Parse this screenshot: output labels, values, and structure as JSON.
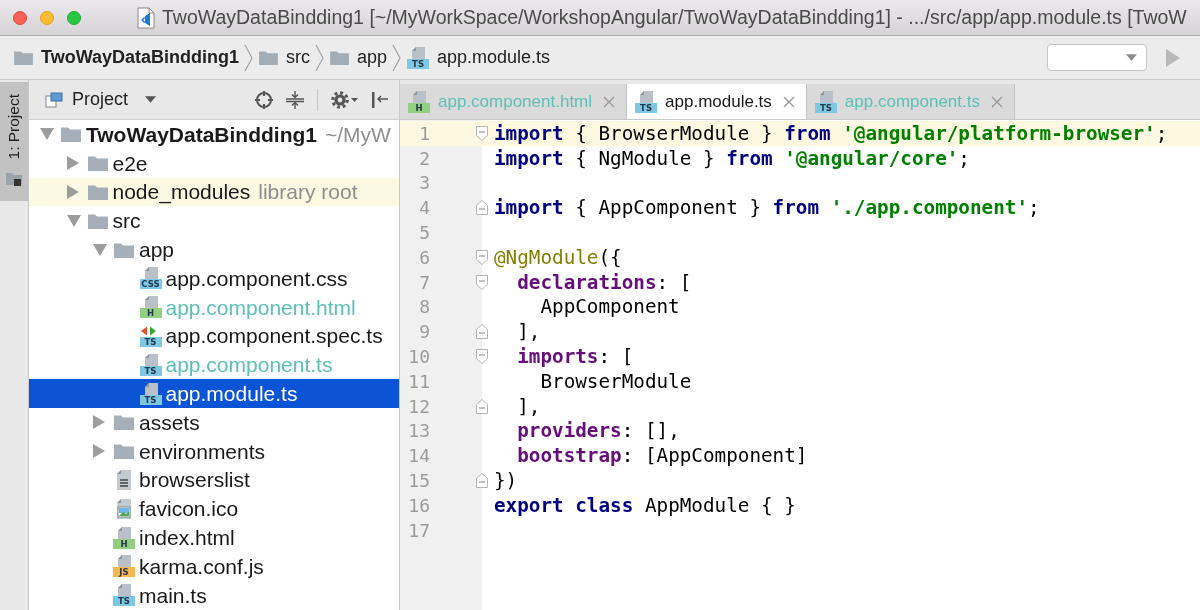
{
  "window": {
    "title": "TwoWayDataBindding1 [~/MyWorkSpace/WorkshopAngular/TwoWayDataBindding1] - .../src/app/app.module.ts [TwoW"
  },
  "breadcrumb": [
    {
      "label": "TwoWayDataBindding1",
      "kind": "project"
    },
    {
      "label": "src",
      "kind": "folder"
    },
    {
      "label": "app",
      "kind": "folder"
    },
    {
      "label": "app.module.ts",
      "kind": "ts",
      "badge": "TS"
    }
  ],
  "side_tabs": [
    {
      "label": "1: Project",
      "selected": true
    }
  ],
  "project_panel": {
    "title": "Project"
  },
  "tree": [
    {
      "name": "TwoWayDataBindding1",
      "kind": "project",
      "note": "~/MyW",
      "expanded": true,
      "selected": false,
      "highlighted": false,
      "children": [
        {
          "name": "e2e",
          "kind": "folder",
          "expanded": false,
          "selected": false,
          "highlighted": false
        },
        {
          "name": "node_modules",
          "kind": "folder",
          "note": "library root",
          "expanded": false,
          "selected": false,
          "highlighted": true
        },
        {
          "name": "src",
          "kind": "folder",
          "expanded": true,
          "selected": false,
          "highlighted": false,
          "children": [
            {
              "name": "app",
              "kind": "folder",
              "expanded": true,
              "selected": false,
              "highlighted": false,
              "children": [
                {
                  "name": "app.component.css",
                  "kind": "css",
                  "badge": "CSS",
                  "selected": false,
                  "highlighted": false
                },
                {
                  "name": "app.component.html",
                  "kind": "html",
                  "badge": "H",
                  "color": "#5cc0b6",
                  "selected": false,
                  "highlighted": false
                },
                {
                  "name": "app.component.spec.ts",
                  "kind": "test",
                  "badge": "TS",
                  "selected": false,
                  "highlighted": false
                },
                {
                  "name": "app.component.ts",
                  "kind": "ts",
                  "badge": "TS",
                  "color": "#5cc0b6",
                  "selected": false,
                  "highlighted": false
                },
                {
                  "name": "app.module.ts",
                  "kind": "ts",
                  "badge": "TS",
                  "selected": true,
                  "highlighted": false
                }
              ]
            },
            {
              "name": "assets",
              "kind": "folder",
              "expanded": false,
              "selected": false,
              "highlighted": false
            },
            {
              "name": "environments",
              "kind": "folder",
              "expanded": false,
              "selected": false,
              "highlighted": false
            },
            {
              "name": "browserslist",
              "kind": "text",
              "selected": false,
              "highlighted": false
            },
            {
              "name": "favicon.ico",
              "kind": "image",
              "selected": false,
              "highlighted": false
            },
            {
              "name": "index.html",
              "kind": "html",
              "badge": "H",
              "selected": false,
              "highlighted": false
            },
            {
              "name": "karma.conf.js",
              "kind": "js",
              "badge": "JS",
              "selected": false,
              "highlighted": false
            },
            {
              "name": "main.ts",
              "kind": "ts",
              "badge": "TS",
              "selected": false,
              "highlighted": false
            }
          ]
        }
      ]
    }
  ],
  "editor_tabs": [
    {
      "label": "app.component.html",
      "kind": "html",
      "badge": "H",
      "selected": false,
      "color": "#5cc0b6"
    },
    {
      "label": "app.module.ts",
      "kind": "ts",
      "badge": "TS",
      "selected": true
    },
    {
      "label": "app.component.ts",
      "kind": "ts",
      "badge": "TS",
      "selected": false,
      "color": "#5cc0b6"
    }
  ],
  "code_lines": [
    {
      "number": "1",
      "kind": "open",
      "current": true,
      "segments": [
        {
          "text": "import",
          "kind": "keyword"
        },
        {
          "text": " { BrowserModule } ",
          "kind": "plain"
        },
        {
          "text": "from ",
          "kind": "keyword"
        },
        {
          "text": "'@angular/platform-browser'",
          "kind": "string"
        },
        {
          "text": ";",
          "kind": "plain"
        }
      ]
    },
    {
      "number": "2",
      "kind": "plain",
      "current": false,
      "segments": [
        {
          "text": "import",
          "kind": "keyword"
        },
        {
          "text": " { NgModule } ",
          "kind": "plain"
        },
        {
          "text": "from ",
          "kind": "keyword"
        },
        {
          "text": "'@angular/core'",
          "kind": "string"
        },
        {
          "text": ";",
          "kind": "plain"
        }
      ]
    },
    {
      "number": "3",
      "kind": "plain",
      "current": false
    },
    {
      "number": "4",
      "kind": "close",
      "current": false,
      "segments": [
        {
          "text": "import",
          "kind": "keyword"
        },
        {
          "text": " { AppComponent } ",
          "kind": "plain"
        },
        {
          "text": "from ",
          "kind": "keyword"
        },
        {
          "text": "'./app.component'",
          "kind": "string"
        },
        {
          "text": ";",
          "kind": "plain"
        }
      ]
    },
    {
      "number": "5",
      "kind": "plain",
      "current": false
    },
    {
      "number": "6",
      "kind": "open",
      "current": false,
      "segments": [
        {
          "text": "@NgModule",
          "kind": "decorator"
        },
        {
          "text": "({",
          "kind": "plain"
        }
      ]
    },
    {
      "number": "7",
      "kind": "open",
      "current": false,
      "segments": [
        {
          "text": "  declarations",
          "kind": "property"
        },
        {
          "text": ": [",
          "kind": "plain"
        }
      ]
    },
    {
      "number": "8",
      "kind": "plain",
      "current": false,
      "segments": [
        {
          "text": "    AppComponent",
          "kind": "plain"
        }
      ]
    },
    {
      "number": "9",
      "kind": "close",
      "current": false,
      "segments": [
        {
          "text": "  ],",
          "kind": "plain"
        }
      ]
    },
    {
      "number": "10",
      "kind": "open",
      "current": false,
      "segments": [
        {
          "text": "  imports",
          "kind": "property"
        },
        {
          "text": ": [",
          "kind": "plain"
        }
      ]
    },
    {
      "number": "11",
      "kind": "plain",
      "current": false,
      "segments": [
        {
          "text": "    BrowserModule",
          "kind": "plain"
        }
      ]
    },
    {
      "number": "12",
      "kind": "close",
      "current": false,
      "segments": [
        {
          "text": "  ],",
          "kind": "plain"
        }
      ]
    },
    {
      "number": "13",
      "kind": "plain",
      "current": false,
      "segments": [
        {
          "text": "  providers",
          "kind": "property"
        },
        {
          "text": ": [],",
          "kind": "plain"
        }
      ]
    },
    {
      "number": "14",
      "kind": "plain",
      "current": false,
      "segments": [
        {
          "text": "  bootstrap",
          "kind": "property"
        },
        {
          "text": ": [AppComponent]",
          "kind": "plain"
        }
      ]
    },
    {
      "number": "15",
      "kind": "close",
      "current": false,
      "segments": [
        {
          "text": "})",
          "kind": "plain"
        }
      ]
    },
    {
      "number": "16",
      "kind": "plain",
      "current": false,
      "segments": [
        {
          "text": "export ",
          "kind": "keyword"
        },
        {
          "text": "class ",
          "kind": "keyword"
        },
        {
          "text": "AppModule { }",
          "kind": "plain"
        }
      ]
    },
    {
      "number": "17",
      "kind": "plain",
      "current": false
    }
  ]
}
